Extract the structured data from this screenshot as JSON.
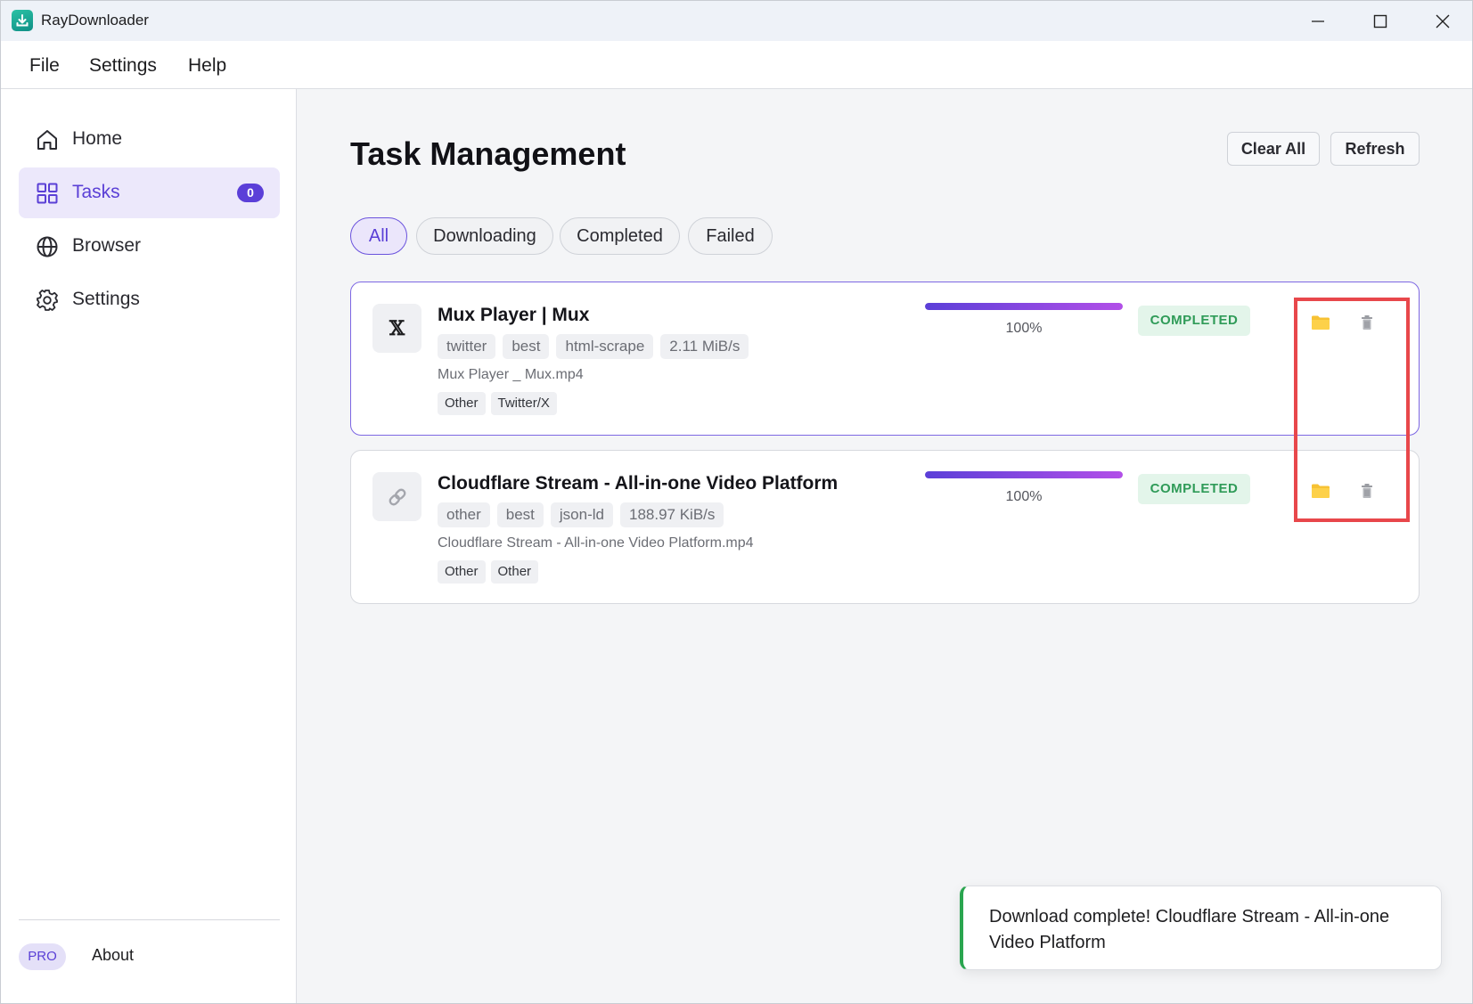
{
  "app": {
    "title": "RayDownloader"
  },
  "menu": {
    "items": [
      "File",
      "Settings",
      "Help"
    ]
  },
  "sidebar": {
    "items": [
      {
        "label": "Home",
        "icon": "home-icon"
      },
      {
        "label": "Tasks",
        "icon": "grid-icon",
        "badge": "0",
        "active": true
      },
      {
        "label": "Browser",
        "icon": "globe-icon"
      },
      {
        "label": "Settings",
        "icon": "gear-icon"
      }
    ],
    "pro_label": "PRO",
    "about_label": "About"
  },
  "main": {
    "title": "Task Management",
    "clear_all_label": "Clear All",
    "refresh_label": "Refresh",
    "filters": [
      {
        "label": "All",
        "active": true
      },
      {
        "label": "Downloading"
      },
      {
        "label": "Completed"
      },
      {
        "label": "Failed"
      }
    ],
    "tasks": [
      {
        "title": "Mux Player | Mux",
        "thumb": "𝕏",
        "thumb_icon": "x-logo-icon",
        "tags": [
          "twitter",
          "best",
          "html-scrape",
          "2.11 MiB/s"
        ],
        "filename": "Mux Player _ Mux.mp4",
        "categories": [
          "Other",
          "Twitter/X"
        ],
        "progress": 1.0,
        "progress_label": "100%",
        "status": "COMPLETED"
      },
      {
        "title": "Cloudflare Stream - All-in-one Video Platform",
        "thumb_icon": "link-icon",
        "tags": [
          "other",
          "best",
          "json-ld",
          "188.97 KiB/s"
        ],
        "filename": "Cloudflare Stream - All-in-one Video Platform.mp4",
        "categories": [
          "Other",
          "Other"
        ],
        "progress": 1.0,
        "progress_label": "100%",
        "status": "COMPLETED"
      }
    ]
  },
  "toast": {
    "message": "Download complete! Cloudflare Stream - All-in-one Video Platform"
  },
  "colors": {
    "accent": "#5b3fd8",
    "status_completed": "#2f9b58",
    "toast_success": "#2aa54f",
    "highlight": "#e8474b"
  }
}
